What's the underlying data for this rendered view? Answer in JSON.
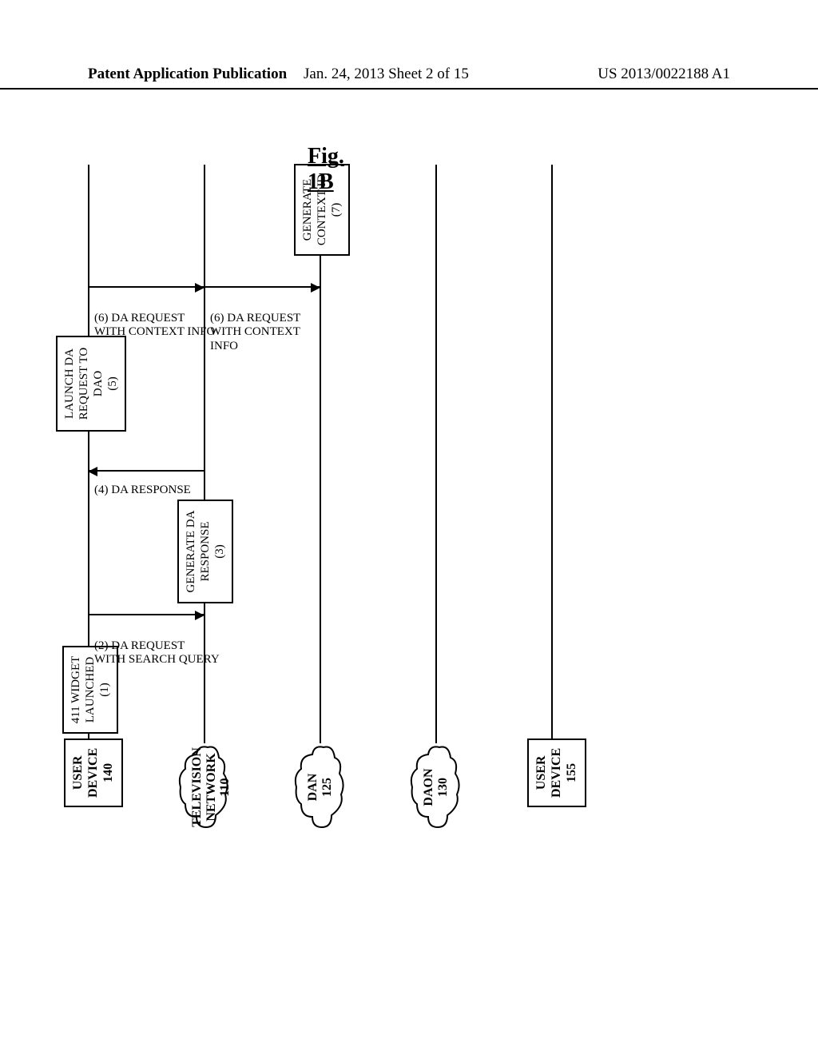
{
  "header": {
    "left": "Patent Application Publication",
    "center": "Jan. 24, 2013  Sheet 2 of 15",
    "right": "US 2013/0022188 A1"
  },
  "participants": {
    "user_device_140": {
      "line1": "USER",
      "line2": "DEVICE",
      "line3": "140"
    },
    "television_network_110": {
      "line1": "TELEVISION",
      "line2": "NETWORK 110"
    },
    "dan_125": {
      "line1": "DAN",
      "line2": "125"
    },
    "daon_130": {
      "line1": "DAON",
      "line2": "130"
    },
    "user_device_155": {
      "line1": "USER",
      "line2": "DEVICE",
      "line3": "155"
    }
  },
  "activities": {
    "a1": {
      "line1": "411 WIDGET",
      "line2": "LAUNCHED",
      "line3": "(1)"
    },
    "a3": {
      "line1": "GENERATE DA",
      "line2": "RESPONSE",
      "line3": "(3)"
    },
    "a5": {
      "line1": "LAUNCH DA",
      "line2": "REQUEST TO",
      "line3": "DAO",
      "line4": "(5)"
    },
    "a7": {
      "line1": "GENERATE",
      "line2": "CONTEXT ID",
      "line3": "(7)"
    }
  },
  "messages": {
    "m2": {
      "line1": "(2)  DA REQUEST",
      "line2": "WITH SEARCH QUERY"
    },
    "m4": {
      "line1": "(4)  DA RESPONSE"
    },
    "m6a": {
      "line1": "(6)  DA REQUEST",
      "line2": "WITH CONTEXT INFO"
    },
    "m6b": {
      "line1": "(6)  DA REQUEST",
      "line2": "WITH CONTEXT",
      "line3": "INFO"
    }
  },
  "figure_label": "Fig. 1B"
}
